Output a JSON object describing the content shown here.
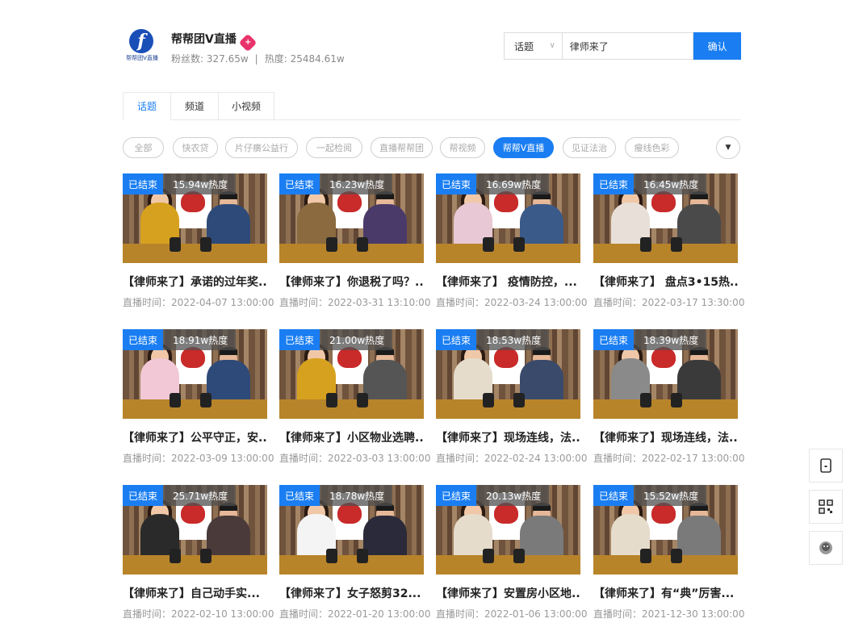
{
  "header": {
    "logo_text": "帮帮团V直播",
    "title": "帮帮团V直播",
    "badge_glyph": "+",
    "fans_label": "粉丝数: 327.65w",
    "separator": "|",
    "heat_label": "热度: 25484.61w"
  },
  "search": {
    "category": "话题",
    "input_value": "律师来了",
    "confirm_label": "确认"
  },
  "tabs": [
    {
      "label": "话题",
      "active": true
    },
    {
      "label": "频道",
      "active": false
    },
    {
      "label": "小视频",
      "active": false
    }
  ],
  "chips": [
    {
      "label": "全部",
      "active": false
    },
    {
      "label": "快农贷",
      "active": false
    },
    {
      "label": "片仔癀公益行",
      "active": false
    },
    {
      "label": "一起检阅",
      "active": false
    },
    {
      "label": "直播帮帮团",
      "active": false
    },
    {
      "label": "帮视频",
      "active": false
    },
    {
      "label": "帮帮V直播",
      "active": true
    },
    {
      "label": "见证法治",
      "active": false
    },
    {
      "label": "瘦线色彩",
      "active": false
    }
  ],
  "status_label": "已结束",
  "cards": [
    {
      "heat": "15.94w热度",
      "title": "【律师来了】承诺的过年奖...",
      "date": "直播时间：2022-04-07 13:00:00",
      "jacket": "#d6a11e",
      "suit": "#2e4a78"
    },
    {
      "heat": "16.23w热度",
      "title": "【律师来了】你退税了吗？...",
      "date": "直播时间：2022-03-31 13:10:00",
      "jacket": "#8a6a3e",
      "suit": "#4a3a6a"
    },
    {
      "heat": "16.69w热度",
      "title": "【律师来了】 疫情防控，...",
      "date": "直播时间：2022-03-24 13:00:00",
      "jacket": "#e8c8d4",
      "suit": "#3a5a8a"
    },
    {
      "heat": "16.45w热度",
      "title": "【律师来了】 盘点3•15热...",
      "date": "直播时间：2022-03-17 13:30:00",
      "jacket": "#e8e0d8",
      "suit": "#4a4a4a"
    },
    {
      "heat": "18.91w热度",
      "title": "【律师来了】公平守正，安...",
      "date": "直播时间：2022-03-09 13:00:00",
      "jacket": "#f2c8d6",
      "suit": "#2e4a78"
    },
    {
      "heat": "21.00w热度",
      "title": "【律师来了】小区物业选聘...",
      "date": "直播时间：2022-03-03 13:00:00",
      "jacket": "#d6a11e",
      "suit": "#555555"
    },
    {
      "heat": "18.53w热度",
      "title": "【律师来了】现场连线，法...",
      "date": "直播时间：2022-02-24 13:00:00",
      "jacket": "#e6dccc",
      "suit": "#3a4a6a"
    },
    {
      "heat": "18.39w热度",
      "title": "【律师来了】现场连线，法...",
      "date": "直播时间：2022-02-17 13:00:00",
      "jacket": "#8a8a8a",
      "suit": "#3a3a3a"
    },
    {
      "heat": "25.71w热度",
      "title": "【律师来了】自己动手实...",
      "date": "直播时间：2022-02-10 13:00:00",
      "jacket": "#2a2a2a",
      "suit": "#4a3a3a"
    },
    {
      "heat": "18.78w热度",
      "title": "【律师来了】女子怒剪32...",
      "date": "直播时间：2022-01-20 13:00:00",
      "jacket": "#f4f4f4",
      "suit": "#2a2a3a"
    },
    {
      "heat": "20.13w热度",
      "title": "【律师来了】安置房小区地...",
      "date": "直播时间：2022-01-06 13:00:00",
      "jacket": "#e6dccc",
      "suit": "#7a7a7a"
    },
    {
      "heat": "15.52w热度",
      "title": "【律师来了】有“典”厉害...",
      "date": "直播时间：2021-12-30 13:00:00",
      "jacket": "#e6dccc",
      "suit": "#7a7a7a"
    }
  ],
  "side_buttons": [
    {
      "icon": "phone-icon"
    },
    {
      "icon": "qr-code-icon"
    },
    {
      "icon": "avatar-icon"
    }
  ],
  "colors": {
    "accent": "#1a7ef2",
    "badge": "#e8336b"
  }
}
